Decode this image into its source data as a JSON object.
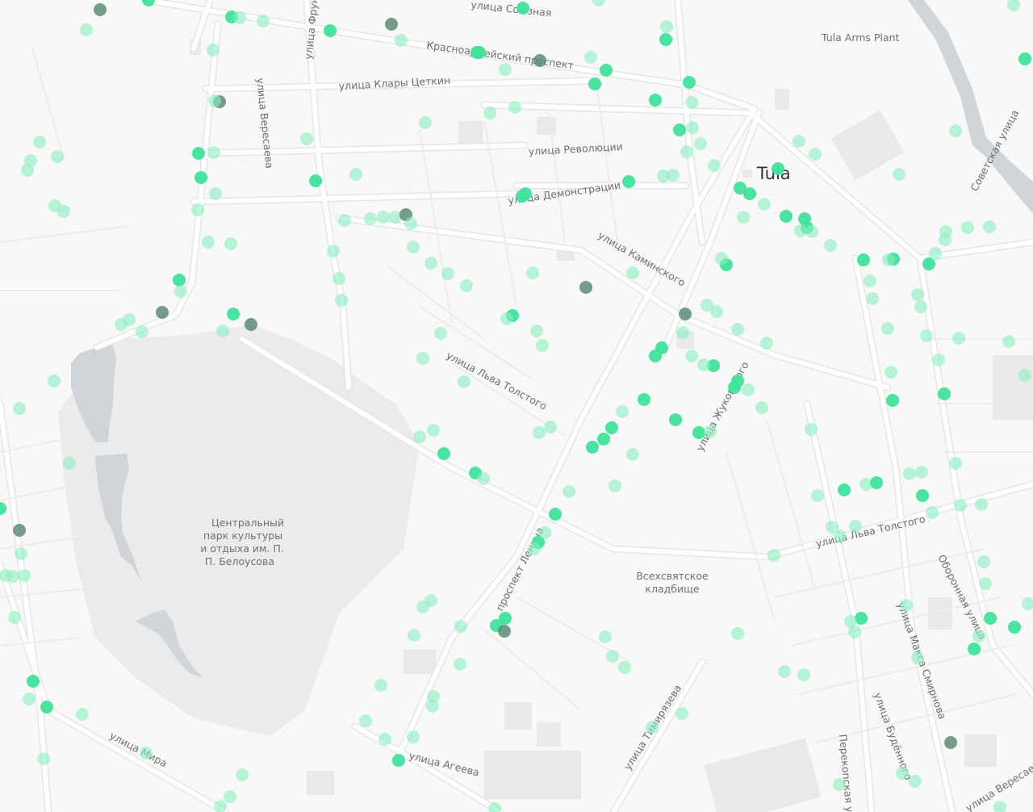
{
  "colors": {
    "background": "#f8f8f8",
    "road": "#ffffff",
    "road_edge": "#e6e6e6",
    "park": "#ebebeb",
    "water": "#cfd5d8",
    "building": "#e9e9e9",
    "stop_green": "#3fe39a",
    "stop_light": "#8bf0c0",
    "stop_gray": "#5d8c76"
  },
  "labels": {
    "city": "Tula",
    "tula_arms_plant": "Tula Arms Plant",
    "ul_sovetskaya_top": "улица Союзная",
    "krasnoarmeisky": "Красноармейский проспект",
    "klary_tsetkin": "улица Клары Цеткин",
    "revolyutsii": "улица Революции",
    "demonstratsii": "улица Демонстрации",
    "kaminskogo": "улица Каминского",
    "lva_tolstogo_1": "улица Льва Толстого",
    "lva_tolstogo_2": "улица Льва Толстого",
    "zhukovskogo": "улица Жуковского",
    "prospekt_lenina": "проспект Ленина",
    "sovetskaya": "Советская улица",
    "oboronnaya": "Оборонная улица",
    "maksa_smirnova": "улица Макса Смирнова",
    "budennogo": "улица Будённого",
    "perekopskaya": "Перекопская улица",
    "timiryazeva": "улица Тимирязева",
    "ageeva": "улица Агеева",
    "mira": "улица Мира",
    "veresaeva": "улица Вересаева",
    "frunze": "улица Фрунзе",
    "veresaeva_2": "улица Вересаева",
    "park": "Центральный парк культуры и отдыха им. П. П. Белоусова",
    "cemetery": "Всехсвятское кладбище"
  },
  "stops": [
    [
      184,
      0,
      "g"
    ],
    [
      124,
      12,
      "d"
    ],
    [
      107,
      37,
      "l"
    ],
    [
      287,
      21,
      "g"
    ],
    [
      297,
      22,
      "l"
    ],
    [
      326,
      26,
      "l"
    ],
    [
      409,
      38,
      "g"
    ],
    [
      485,
      30,
      "d"
    ],
    [
      497,
      50,
      "l"
    ],
    [
      591,
      65,
      "g"
    ],
    [
      594,
      65,
      "g"
    ],
    [
      648,
      10,
      "g"
    ],
    [
      669,
      75,
      "d"
    ],
    [
      626,
      86,
      "l"
    ],
    [
      732,
      71,
      "l"
    ],
    [
      751,
      87,
      "g"
    ],
    [
      737,
      104,
      "g"
    ],
    [
      742,
      0,
      "l"
    ],
    [
      826,
      33,
      "l"
    ],
    [
      825,
      49,
      "g"
    ],
    [
      854,
      102,
      "g"
    ],
    [
      857,
      127,
      "l"
    ],
    [
      812,
      124,
      "g"
    ],
    [
      842,
      161,
      "g"
    ],
    [
      858,
      158,
      "l"
    ],
    [
      868,
      178,
      "l"
    ],
    [
      851,
      188,
      "l"
    ],
    [
      264,
      62,
      "l"
    ],
    [
      272,
      126,
      "d"
    ],
    [
      266,
      125,
      "l"
    ],
    [
      246,
      190,
      "g"
    ],
    [
      265,
      189,
      "l"
    ],
    [
      249,
      220,
      "g"
    ],
    [
      267,
      240,
      "l"
    ],
    [
      245,
      260,
      "l"
    ],
    [
      258,
      300,
      "l"
    ],
    [
      286,
      302,
      "l"
    ],
    [
      222,
      347,
      "g"
    ],
    [
      224,
      361,
      "l"
    ],
    [
      201,
      387,
      "d"
    ],
    [
      289,
      389,
      "g"
    ],
    [
      311,
      402,
      "d"
    ],
    [
      276,
      410,
      "l"
    ],
    [
      176,
      411,
      "l"
    ],
    [
      150,
      402,
      "l"
    ],
    [
      160,
      396,
      "l"
    ],
    [
      49,
      176,
      "l"
    ],
    [
      38,
      199,
      "l"
    ],
    [
      34,
      211,
      "l"
    ],
    [
      71,
      194,
      "l"
    ],
    [
      68,
      255,
      "l"
    ],
    [
      79,
      262,
      "l"
    ],
    [
      380,
      172,
      "l"
    ],
    [
      391,
      224,
      "g"
    ],
    [
      441,
      216,
      "l"
    ],
    [
      427,
      273,
      "l"
    ],
    [
      459,
      271,
      "l"
    ],
    [
      475,
      269,
      "l"
    ],
    [
      490,
      269,
      "l"
    ],
    [
      503,
      266,
      "d"
    ],
    [
      509,
      277,
      "l"
    ],
    [
      413,
      311,
      "l"
    ],
    [
      420,
      345,
      "l"
    ],
    [
      423,
      372,
      "l"
    ],
    [
      512,
      306,
      "l"
    ],
    [
      534,
      326,
      "l"
    ],
    [
      555,
      339,
      "l"
    ],
    [
      578,
      354,
      "l"
    ],
    [
      527,
      152,
      "l"
    ],
    [
      607,
      140,
      "l"
    ],
    [
      638,
      133,
      "l"
    ],
    [
      647,
      243,
      "g"
    ],
    [
      651,
      240,
      "g"
    ],
    [
      660,
      338,
      "l"
    ],
    [
      635,
      391,
      "g"
    ],
    [
      628,
      395,
      "l"
    ],
    [
      546,
      413,
      "l"
    ],
    [
      524,
      444,
      "l"
    ],
    [
      575,
      473,
      "l"
    ],
    [
      665,
      410,
      "l"
    ],
    [
      672,
      428,
      "l"
    ],
    [
      726,
      356,
      "d"
    ],
    [
      779,
      225,
      "g"
    ],
    [
      822,
      218,
      "l"
    ],
    [
      834,
      217,
      "l"
    ],
    [
      820,
      431,
      "g"
    ],
    [
      812,
      441,
      "g"
    ],
    [
      849,
      389,
      "d"
    ],
    [
      846,
      412,
      "l"
    ],
    [
      798,
      495,
      "g"
    ],
    [
      784,
      338,
      "l"
    ],
    [
      876,
      378,
      "l"
    ],
    [
      888,
      386,
      "l"
    ],
    [
      964,
      209,
      "g"
    ],
    [
      917,
      233,
      "g"
    ],
    [
      929,
      240,
      "g"
    ],
    [
      947,
      253,
      "l"
    ],
    [
      885,
      205,
      "l"
    ],
    [
      921,
      269,
      "l"
    ],
    [
      974,
      268,
      "g"
    ],
    [
      997,
      271,
      "g"
    ],
    [
      1000,
      282,
      "g"
    ],
    [
      992,
      286,
      "l"
    ],
    [
      1006,
      287,
      "l"
    ],
    [
      1029,
      304,
      "l"
    ],
    [
      1010,
      191,
      "l"
    ],
    [
      990,
      175,
      "l"
    ],
    [
      1070,
      322,
      "g"
    ],
    [
      1107,
      321,
      "g"
    ],
    [
      1101,
      322,
      "l"
    ],
    [
      1078,
      348,
      "l"
    ],
    [
      1081,
      370,
      "l"
    ],
    [
      1100,
      407,
      "l"
    ],
    [
      1104,
      461,
      "l"
    ],
    [
      1106,
      496,
      "g"
    ],
    [
      1151,
      327,
      "g"
    ],
    [
      1159,
      314,
      "l"
    ],
    [
      1171,
      297,
      "l"
    ],
    [
      1172,
      287,
      "l"
    ],
    [
      1199,
      282,
      "l"
    ],
    [
      1226,
      281,
      "l"
    ],
    [
      1137,
      365,
      "l"
    ],
    [
      1141,
      380,
      "l"
    ],
    [
      1148,
      416,
      "l"
    ],
    [
      1163,
      446,
      "l"
    ],
    [
      1170,
      488,
      "g"
    ],
    [
      1188,
      419,
      "l"
    ],
    [
      1114,
      216,
      "l"
    ],
    [
      1184,
      162,
      "l"
    ],
    [
      1270,
      73,
      "g"
    ],
    [
      1256,
      6,
      "l"
    ],
    [
      1250,
      423,
      "l"
    ],
    [
      1270,
      465,
      "l"
    ],
    [
      900,
      328,
      "g"
    ],
    [
      894,
      320,
      "l"
    ],
    [
      914,
      408,
      "l"
    ],
    [
      950,
      425,
      "l"
    ],
    [
      884,
      453,
      "g"
    ],
    [
      872,
      452,
      "l"
    ],
    [
      857,
      441,
      "l"
    ],
    [
      914,
      472,
      "g"
    ],
    [
      910,
      480,
      "g"
    ],
    [
      927,
      483,
      "l"
    ],
    [
      944,
      505,
      "l"
    ],
    [
      837,
      520,
      "g"
    ],
    [
      866,
      536,
      "g"
    ],
    [
      880,
      535,
      "l"
    ],
    [
      1005,
      532,
      "l"
    ],
    [
      758,
      530,
      "g"
    ],
    [
      771,
      510,
      "l"
    ],
    [
      748,
      544,
      "g"
    ],
    [
      734,
      554,
      "g"
    ],
    [
      784,
      563,
      "l"
    ],
    [
      762,
      602,
      "l"
    ],
    [
      705,
      609,
      "l"
    ],
    [
      688,
      637,
      "g"
    ],
    [
      675,
      660,
      "l"
    ],
    [
      667,
      672,
      "g"
    ],
    [
      662,
      680,
      "l"
    ],
    [
      520,
      541,
      "l"
    ],
    [
      537,
      533,
      "l"
    ],
    [
      550,
      562,
      "g"
    ],
    [
      589,
      586,
      "g"
    ],
    [
      599,
      593,
      "l"
    ],
    [
      668,
      536,
      "l"
    ],
    [
      682,
      529,
      "l"
    ],
    [
      1013,
      614,
      "l"
    ],
    [
      1046,
      607,
      "g"
    ],
    [
      1073,
      600,
      "l"
    ],
    [
      1086,
      598,
      "g"
    ],
    [
      1127,
      587,
      "l"
    ],
    [
      1142,
      585,
      "l"
    ],
    [
      1184,
      574,
      "l"
    ],
    [
      1060,
      652,
      "l"
    ],
    [
      1031,
      653,
      "l"
    ],
    [
      1041,
      664,
      "l"
    ],
    [
      1143,
      614,
      "g"
    ],
    [
      1155,
      635,
      "l"
    ],
    [
      1190,
      626,
      "l"
    ],
    [
      1216,
      625,
      "l"
    ],
    [
      1219,
      696,
      "l"
    ],
    [
      1221,
      723,
      "l"
    ],
    [
      1227,
      766,
      "g"
    ],
    [
      1257,
      777,
      "g"
    ],
    [
      1274,
      748,
      "l"
    ],
    [
      1213,
      788,
      "l"
    ],
    [
      1207,
      804,
      "g"
    ],
    [
      1123,
      750,
      "l"
    ],
    [
      1067,
      766,
      "g"
    ],
    [
      1054,
      770,
      "l"
    ],
    [
      1059,
      783,
      "l"
    ],
    [
      1137,
      815,
      "l"
    ],
    [
      959,
      688,
      "l"
    ],
    [
      914,
      785,
      "l"
    ],
    [
      972,
      832,
      "l"
    ],
    [
      996,
      836,
      "l"
    ],
    [
      1118,
      958,
      "l"
    ],
    [
      1134,
      968,
      "l"
    ],
    [
      1178,
      920,
      "d"
    ],
    [
      1040,
      972,
      "l"
    ],
    [
      1239,
      1000,
      "l"
    ],
    [
      534,
      744,
      "l"
    ],
    [
      524,
      752,
      "l"
    ],
    [
      571,
      776,
      "l"
    ],
    [
      615,
      775,
      "g"
    ],
    [
      626,
      766,
      "g"
    ],
    [
      625,
      782,
      "d"
    ],
    [
      513,
      787,
      "l"
    ],
    [
      570,
      823,
      "l"
    ],
    [
      472,
      849,
      "l"
    ],
    [
      537,
      863,
      "l"
    ],
    [
      536,
      875,
      "l"
    ],
    [
      453,
      893,
      "l"
    ],
    [
      512,
      913,
      "l"
    ],
    [
      494,
      942,
      "g"
    ],
    [
      477,
      916,
      "l"
    ],
    [
      750,
      789,
      "l"
    ],
    [
      759,
      813,
      "l"
    ],
    [
      774,
      827,
      "l"
    ],
    [
      808,
      901,
      "l"
    ],
    [
      845,
      884,
      "l"
    ],
    [
      0,
      630,
      "g"
    ],
    [
      24,
      657,
      "d"
    ],
    [
      26,
      686,
      "l"
    ],
    [
      7,
      713,
      "l"
    ],
    [
      16,
      714,
      "l"
    ],
    [
      30,
      713,
      "l"
    ],
    [
      18,
      765,
      "l"
    ],
    [
      41,
      844,
      "g"
    ],
    [
      36,
      866,
      "l"
    ],
    [
      58,
      876,
      "g"
    ],
    [
      102,
      885,
      "l"
    ],
    [
      54,
      940,
      "l"
    ],
    [
      67,
      472,
      "l"
    ],
    [
      24,
      506,
      "l"
    ],
    [
      86,
      574,
      "l"
    ],
    [
      181,
      933,
      "l"
    ],
    [
      300,
      960,
      "l"
    ],
    [
      285,
      987,
      "l"
    ],
    [
      273,
      999,
      "l"
    ],
    [
      613,
      1002,
      "l"
    ]
  ]
}
